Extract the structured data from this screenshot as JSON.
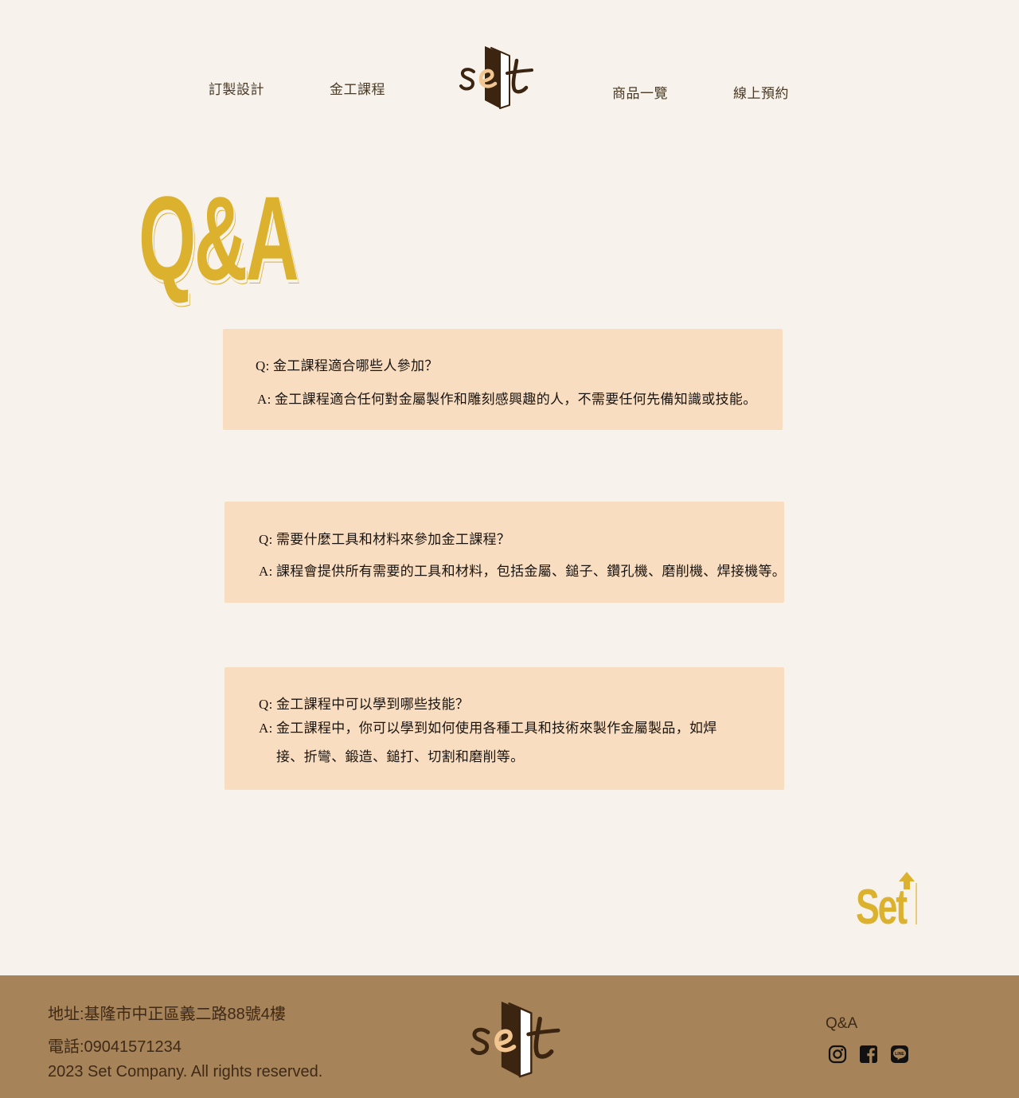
{
  "nav": {
    "left": [
      "訂製設計",
      "金工課程"
    ],
    "right": [
      "商品一覽",
      "線上預約"
    ]
  },
  "brand": {
    "logo_text": "set",
    "badge_text": "Set",
    "colors": {
      "accent": "#dbb12d",
      "logo_dark": "#3b2410",
      "logo_e": "#f2c591",
      "card": "#f8ddc0",
      "footer": "#a68359",
      "background": "#f7f2eb"
    }
  },
  "page": {
    "title": "Q&A"
  },
  "qa": [
    {
      "q_prefix": "Q:",
      "q": "金工課程適合哪些人參加？",
      "a_prefix": "A:",
      "a": "金工課程適合任何對金屬製作和雕刻感興趣的人，不需要任何先備知識或技能。"
    },
    {
      "q_prefix": "Q:",
      "q": "需要什麼工具和材料來參加金工課程？",
      "a_prefix": "A:",
      "a": "課程會提供所有需要的工具和材料，包括金屬、鎚子、鑽孔機、磨削機、焊接機等。"
    },
    {
      "q_prefix": "Q:",
      "q": "金工課程中可以學到哪些技能？",
      "a_prefix": "A:",
      "a": "金工課程中，你可以學到如何使用各種工具和技術來製作金屬製品，如焊接、折彎、鍛造、鎚打、切割和磨削等。"
    }
  ],
  "footer": {
    "address": "地址:基隆市中正區義二路88號4樓",
    "phone": "電話:09041571234",
    "copyright": "2023 Set Company. All rights reserved.",
    "qa_link": "Q&A",
    "social_icons": [
      "instagram-icon",
      "facebook-icon",
      "line-icon"
    ]
  }
}
